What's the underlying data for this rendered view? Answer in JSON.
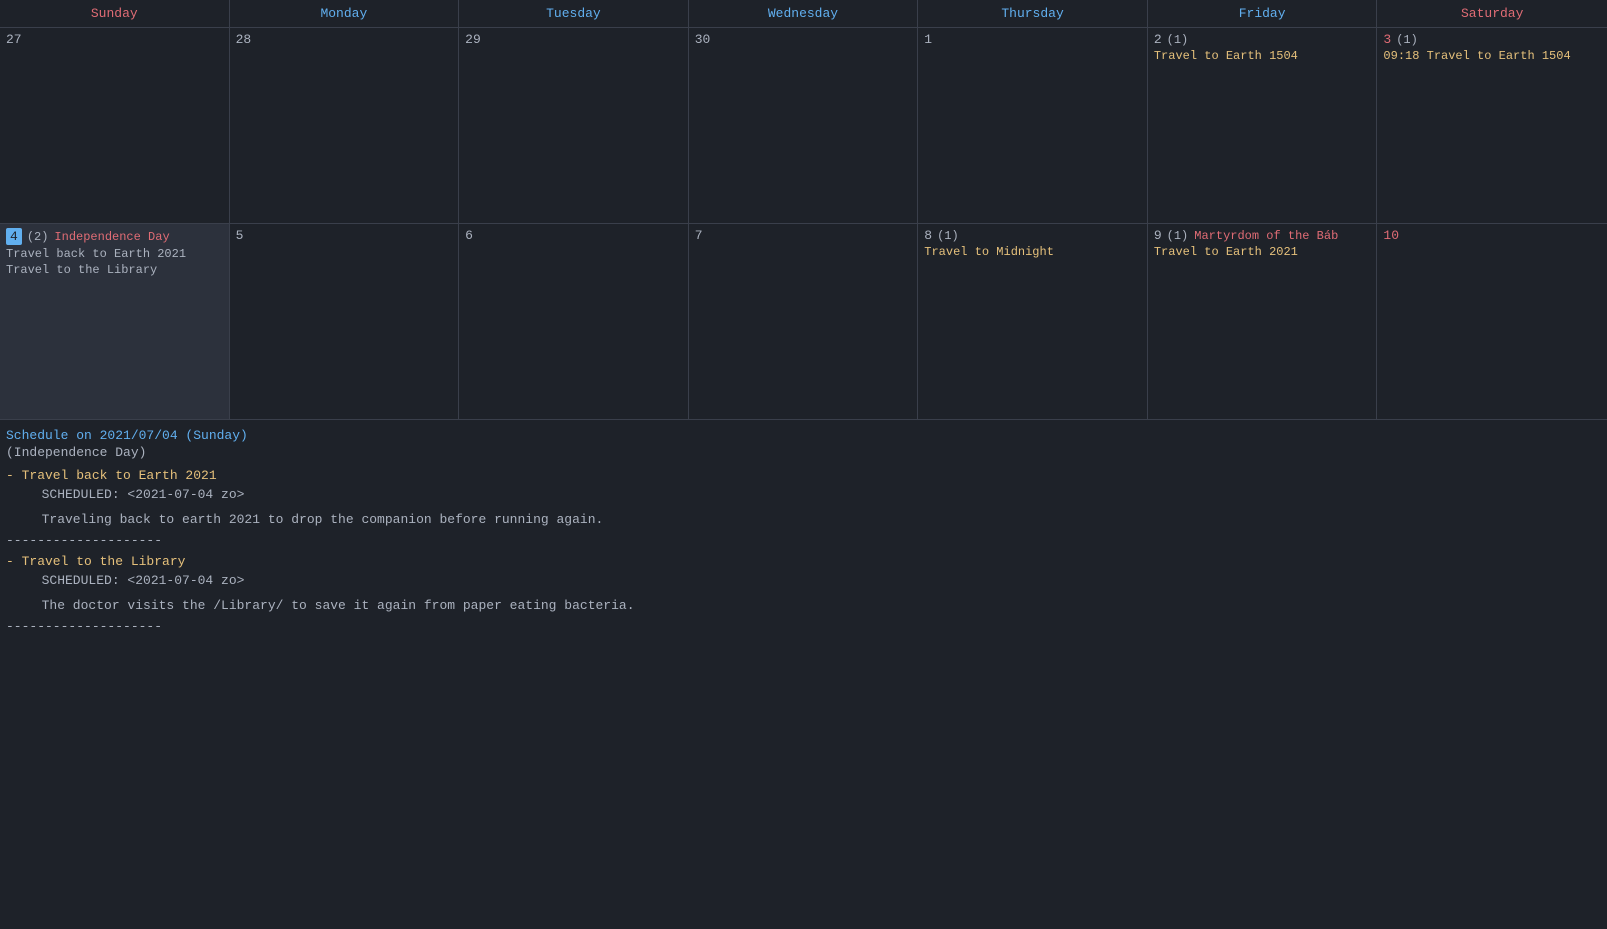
{
  "header": {
    "days": [
      {
        "label": "Sunday",
        "class": "sun"
      },
      {
        "label": "Monday",
        "class": "mon"
      },
      {
        "label": "Tuesday",
        "class": "tue"
      },
      {
        "label": "Wednesday",
        "class": "wed"
      },
      {
        "label": "Thursday",
        "class": "thu"
      },
      {
        "label": "Friday",
        "class": "fri"
      },
      {
        "label": "Saturday",
        "class": "sat"
      }
    ]
  },
  "weeks": [
    {
      "cells": [
        {
          "date": "27",
          "events": [],
          "dateClass": ""
        },
        {
          "date": "28",
          "events": [],
          "dateClass": ""
        },
        {
          "date": "29",
          "events": [],
          "dateClass": ""
        },
        {
          "date": "30",
          "events": [],
          "dateClass": ""
        },
        {
          "date": "1",
          "events": [],
          "dateClass": ""
        },
        {
          "date": "2",
          "count": "(1)",
          "events": [
            {
              "text": "Travel to Earth 1504",
              "class": "event-item"
            }
          ],
          "dateClass": ""
        },
        {
          "date": "3",
          "count": "(1)",
          "events": [
            {
              "text": "09:18 Travel to Earth 1504",
              "class": "event-item"
            }
          ],
          "dateClass": "red"
        }
      ]
    },
    {
      "cells": [
        {
          "date": "4",
          "count": "(2)",
          "holiday": "Independence Day",
          "events": [
            {
              "text": "Travel back to Earth 2021",
              "class": "event-plain"
            },
            {
              "text": "Travel to the Library",
              "class": "event-plain"
            }
          ],
          "dateClass": "today",
          "selected": true
        },
        {
          "date": "5",
          "events": [],
          "dateClass": ""
        },
        {
          "date": "6",
          "events": [],
          "dateClass": ""
        },
        {
          "date": "7",
          "events": [],
          "dateClass": ""
        },
        {
          "date": "8",
          "count": "(1)",
          "events": [
            {
              "text": "Travel to Midnight",
              "class": "event-item"
            }
          ],
          "dateClass": ""
        },
        {
          "date": "9",
          "count": "(1)",
          "holiday": "Martyrdom of the Báb",
          "events": [
            {
              "text": "Travel to Earth 2021",
              "class": "event-item"
            }
          ],
          "dateClass": ""
        },
        {
          "date": "10",
          "events": [],
          "dateClass": "red"
        }
      ]
    }
  ],
  "schedule": {
    "title": "Schedule on 2021/07/04 (Sunday)",
    "holiday": "(Independence Day)",
    "items": [
      {
        "title": "- Travel back to Earth 2021",
        "scheduled": "SCHEDULED: <2021-07-04 zo>",
        "desc": "Traveling back to earth 2021 to drop the companion before running again."
      },
      {
        "divider": "--------------------"
      },
      {
        "title": "- Travel to the Library",
        "scheduled": "SCHEDULED: <2021-07-04 zo>",
        "desc": "The doctor visits the /Library/ to save it again from paper eating bacteria."
      },
      {
        "divider": "--------------------"
      }
    ]
  }
}
